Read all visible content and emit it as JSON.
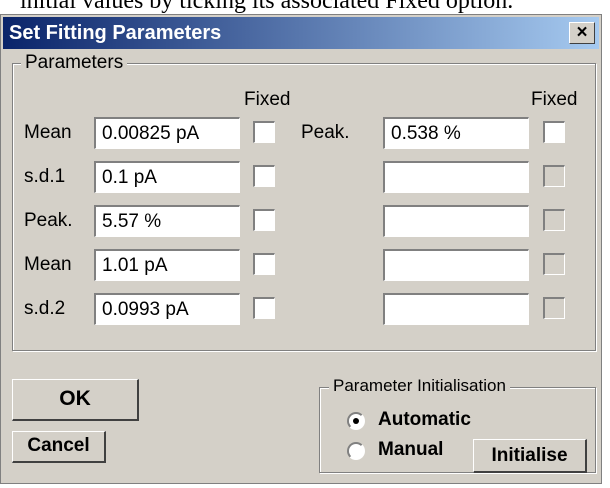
{
  "above_text": "initial values by ticking its associated Fixed option.",
  "window": {
    "title": "Set Fitting Parameters",
    "close_glyph": "×"
  },
  "parameters_group": {
    "legend": "Parameters",
    "fixed_header_left": "Fixed",
    "fixed_header_right": "Fixed",
    "left_rows": [
      {
        "label": "Mean",
        "value": "0.00825 pA",
        "fixed": false
      },
      {
        "label": "s.d.1",
        "value": "0.1 pA",
        "fixed": false
      },
      {
        "label": "Peak.",
        "value": "5.57 %",
        "fixed": false
      },
      {
        "label": "Mean",
        "value": "1.01 pA",
        "fixed": false
      },
      {
        "label": "s.d.2",
        "value": "0.0993 pA",
        "fixed": false
      }
    ],
    "right_rows": [
      {
        "label": "Peak.",
        "value": "0.538 %",
        "fixed": false,
        "enabled": true
      },
      {
        "label": "",
        "value": "",
        "fixed": false,
        "enabled": false
      },
      {
        "label": "",
        "value": "",
        "fixed": false,
        "enabled": false
      },
      {
        "label": "",
        "value": "",
        "fixed": false,
        "enabled": false
      },
      {
        "label": "",
        "value": "",
        "fixed": false,
        "enabled": false
      }
    ]
  },
  "buttons": {
    "ok": "OK",
    "cancel": "Cancel",
    "initialise": "Initialise"
  },
  "init_group": {
    "legend": "Parameter Initialisation",
    "options": [
      {
        "label": "Automatic",
        "selected": true
      },
      {
        "label": "Manual",
        "selected": false
      }
    ]
  }
}
